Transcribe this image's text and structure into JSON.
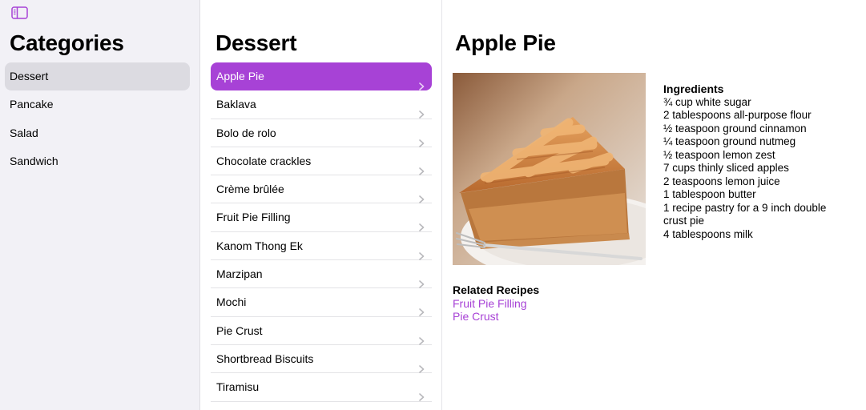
{
  "accent_color": "#a742d6",
  "sidebar": {
    "toggle_icon": "sidebar-toggle-icon",
    "title": "Categories",
    "items": [
      {
        "label": "Dessert",
        "selected": true
      },
      {
        "label": "Pancake",
        "selected": false
      },
      {
        "label": "Salad",
        "selected": false
      },
      {
        "label": "Sandwich",
        "selected": false
      }
    ]
  },
  "list": {
    "title": "Dessert",
    "items": [
      {
        "label": "Apple Pie",
        "selected": true
      },
      {
        "label": "Baklava"
      },
      {
        "label": "Bolo de rolo"
      },
      {
        "label": "Chocolate crackles"
      },
      {
        "label": "Crème brûlée"
      },
      {
        "label": "Fruit Pie Filling"
      },
      {
        "label": "Kanom Thong Ek"
      },
      {
        "label": "Marzipan"
      },
      {
        "label": "Mochi"
      },
      {
        "label": "Pie Crust"
      },
      {
        "label": "Shortbread Biscuits"
      },
      {
        "label": "Tiramisu"
      }
    ]
  },
  "detail": {
    "title": "Apple Pie",
    "image_alt": "apple-pie-photo",
    "ingredients_heading": "Ingredients",
    "ingredients": [
      "¾ cup white sugar",
      "2 tablespoons all-purpose flour",
      "½ teaspoon ground cinnamon",
      "¼ teaspoon ground nutmeg",
      "½ teaspoon lemon zest",
      "7 cups thinly sliced apples",
      "2 teaspoons lemon juice",
      "1 tablespoon butter",
      "1 recipe pastry for a 9 inch double crust pie",
      "4 tablespoons milk"
    ],
    "related_heading": "Related Recipes",
    "related": [
      "Fruit Pie Filling",
      "Pie Crust"
    ]
  }
}
